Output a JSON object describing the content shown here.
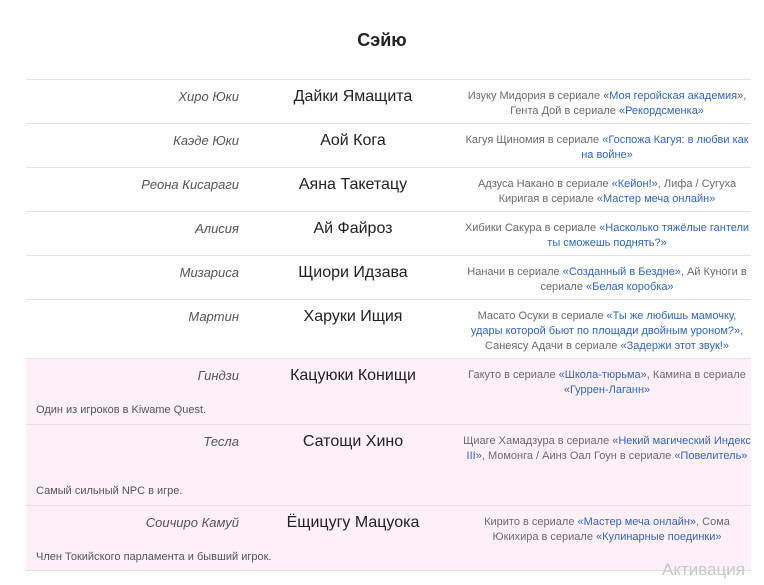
{
  "section_title": "Сэйю",
  "rows": [
    {
      "character": "Хиро Юки",
      "actor": "Дайки Ямащита",
      "roles": [
        {
          "t": "Изуку Мидория в сериале "
        },
        {
          "t": "«Моя геройская академия»",
          "link": true
        },
        {
          "t": ", Гента Дой в сериале "
        },
        {
          "t": "«Рекордсменка»",
          "link": true
        }
      ]
    },
    {
      "character": "Каэде Юки",
      "actor": "Аой Кога",
      "roles": [
        {
          "t": "Кагуя Щиномия в сериале "
        },
        {
          "t": "«Госпожа Кагуя: в любви как на войне»",
          "link": true
        }
      ]
    },
    {
      "character": "Реона Кисараги",
      "actor": "Аяна Такетацу",
      "roles": [
        {
          "t": "Адзуса Накано в сериале "
        },
        {
          "t": "«Кейон!»",
          "link": true
        },
        {
          "t": ", Лифа / Сугуха Киригая в сериале "
        },
        {
          "t": "«Мастер меча онлайн»",
          "link": true
        }
      ]
    },
    {
      "character": "Алисия",
      "actor": "Ай Файроз",
      "roles": [
        {
          "t": "Хибики Сакура в сериале "
        },
        {
          "t": "«Насколько тяжёлые гантели ты сможешь поднять?»",
          "link": true
        }
      ]
    },
    {
      "character": "Мизариса",
      "actor": "Щиори Идзава",
      "roles": [
        {
          "t": "Наначи в сериале "
        },
        {
          "t": "«Созданный в Бездне»",
          "link": true
        },
        {
          "t": ", Ай Куноги в сериале "
        },
        {
          "t": "«Белая коробка»",
          "link": true
        }
      ]
    },
    {
      "character": "Мартин",
      "actor": "Харуки Ищия",
      "roles": [
        {
          "t": "Масато Осуки в сериале "
        },
        {
          "t": "«Ты же любишь мамочку, удары которой бьют по площади двойным уроном?»",
          "link": true
        },
        {
          "t": ", Санеясу Адачи в сериале "
        },
        {
          "t": "«Задержи этот звук!»",
          "link": true
        }
      ]
    },
    {
      "character": "Гиндзи",
      "actor": "Кацуюки Конищи",
      "roles": [
        {
          "t": "Гакуто в сериале "
        },
        {
          "t": "«Школа-тюрьма»",
          "link": true
        },
        {
          "t": ", Камина в сериале "
        },
        {
          "t": "«Гуррен-Лаганн»",
          "link": true
        }
      ],
      "note": "Один из игроков в Kiwame Quest."
    },
    {
      "character": "Тесла",
      "actor": "Сатощи Хино",
      "roles": [
        {
          "t": "Щиаге Хамадзура в сериале "
        },
        {
          "t": "«Некий магический Индекс III»",
          "link": true
        },
        {
          "t": ", Момонга / Аинз Оал Гоун в сериале "
        },
        {
          "t": "«Повелитель»",
          "link": true
        }
      ],
      "note": "Самый сильный NPC в игре."
    },
    {
      "character": "Соичиро Камуй",
      "actor": "Ёщицугу Мацуока",
      "roles": [
        {
          "t": "Кирито в сериале "
        },
        {
          "t": "«Мастер меча онлайн»",
          "link": true
        },
        {
          "t": ", Сома Юкихира в сериале "
        },
        {
          "t": "«Кулинарные поединки»",
          "link": true
        }
      ],
      "note": "Член Токийского парламента и бывший игрок."
    }
  ],
  "watermark": "Активация",
  "colors": {
    "link": "#3366bb",
    "highlight_row": "#fff0f8",
    "divider": "#e3e3e3"
  }
}
